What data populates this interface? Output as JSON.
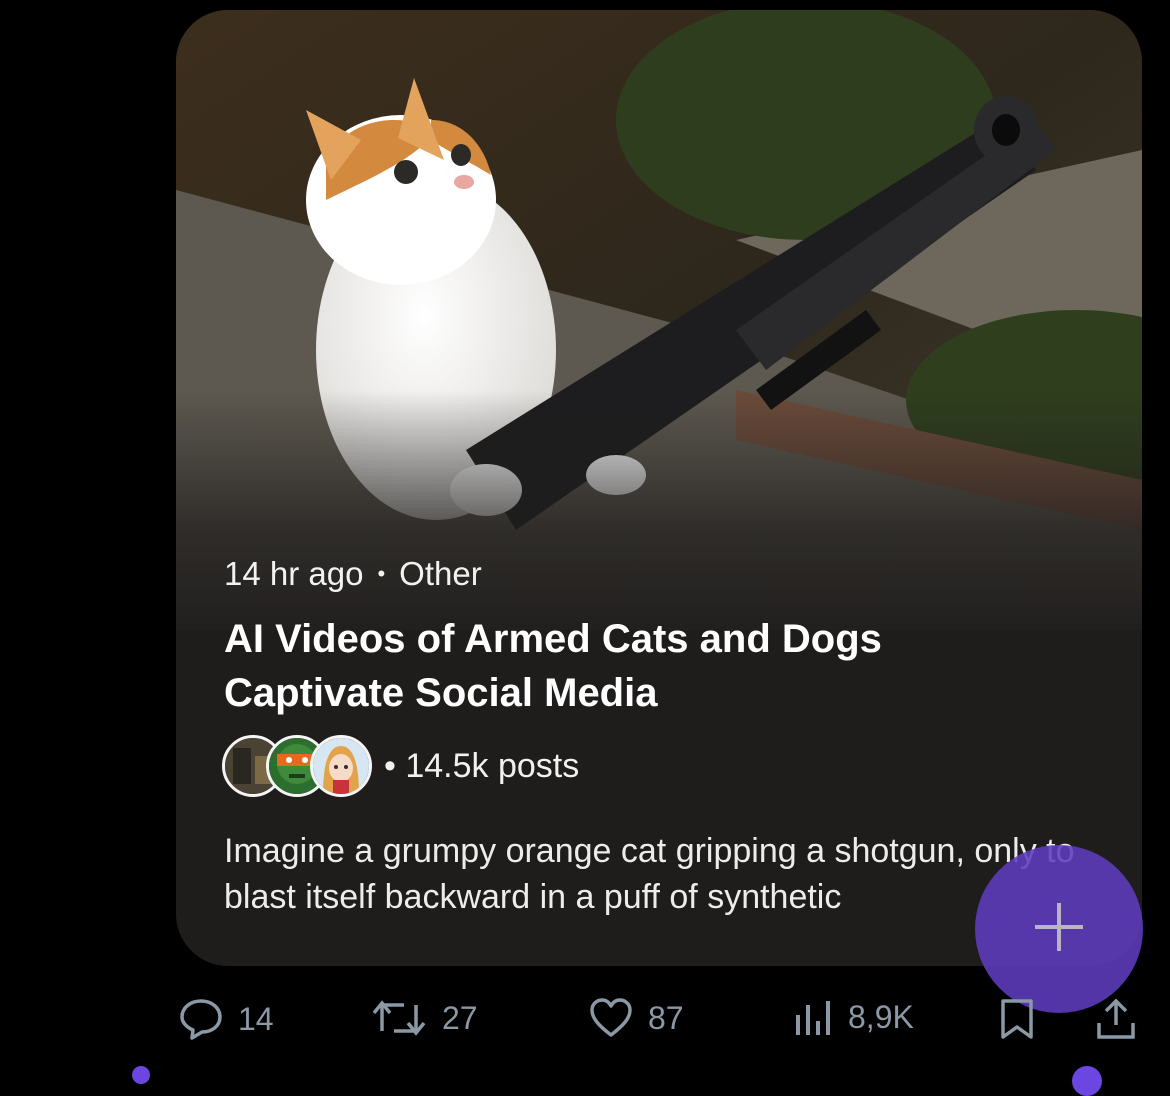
{
  "post": {
    "time_ago": "14 hr ago",
    "separator": "•",
    "category": "Other",
    "title": "AI Videos of Armed Cats and Dogs Captivate Social Media",
    "post_count": "• 14.5k posts",
    "description": "Imagine a grumpy orange cat gripping a shotgun, only to blast itself backward in a puff of synthetic"
  },
  "actions": {
    "replies": "14",
    "reposts": "27",
    "likes": "87",
    "views": "8,9K"
  },
  "icons": {
    "reply": "reply-bubble-icon",
    "repost": "repost-arrows-icon",
    "like": "heart-icon",
    "views": "bar-chart-icon",
    "bookmark": "bookmark-icon",
    "share": "share-upload-icon",
    "compose": "plus-icon"
  },
  "colors": {
    "fab": "#5f3cbe",
    "action_gray": "#8b98a5",
    "card_bg": "#1f1d1c"
  }
}
